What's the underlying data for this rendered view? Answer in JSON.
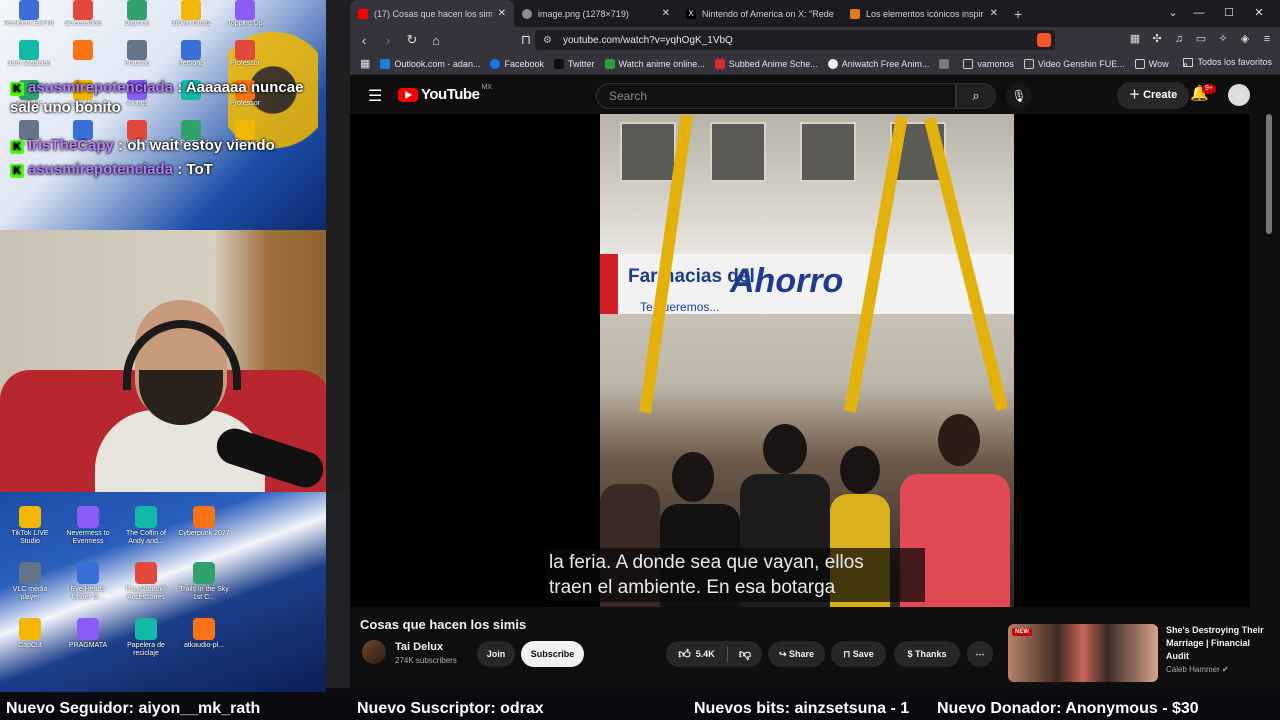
{
  "colors": {
    "yt_red": "#ff0000",
    "accent_chat_badge": "#53fc18",
    "browser_chrome": "#35343d",
    "tab_strip": "#1c1b22"
  },
  "chat": {
    "messages": [
      {
        "user": "asusmirepotenciada",
        "text": "Aaaaaaa nuncae sale uno bonito"
      },
      {
        "user": "IrisTheCapy",
        "text": "oh wait estoy viendo"
      },
      {
        "user": "asusmirepotenciada",
        "text": "ToT"
      }
    ]
  },
  "desktop_icons_top": [
    "Resident Evil Requiem",
    "Screenshots",
    "Digimon",
    "Brown Dust2",
    "Topping Up",
    "Sam Magician",
    "",
    "Phasmo",
    "Persona",
    "Professor",
    "Fairyside",
    "Launcher",
    "Vikings",
    "",
    "Professor",
    "Nira",
    "Streamer.bot",
    "Photopea",
    "SCRIPTLINK",
    "Palworld"
  ],
  "desktop_icons_bottom": [
    {
      "label": "TikTok LIVE Studio"
    },
    {
      "label": "Nevermess to Evermess"
    },
    {
      "label": "The Coffin of Andy and..."
    },
    {
      "label": "Cyberpunk 2077"
    },
    {
      "label": "VLC media player"
    },
    {
      "label": "Eve Hearts Under O..."
    },
    {
      "label": "PlayStation® Accessories"
    },
    {
      "label": "Trails in the Sky 1st C..."
    },
    {
      "label": "CapCut"
    },
    {
      "label": "PRAGMATA"
    },
    {
      "label": "Papelera de reciclaje"
    },
    {
      "label": "atkaudio-pl..."
    }
  ],
  "browser": {
    "tabs": [
      {
        "label": "(17) Cosas que hacen los simis -",
        "active": true,
        "icon": "youtube-icon",
        "color": "#ff0000"
      },
      {
        "label": "image.png (1278×719)",
        "active": false,
        "icon": "globe-icon",
        "color": "#8a8a8a"
      },
      {
        "label": "Nintendo of America on X: \"Redeem",
        "active": false,
        "icon": "x-icon",
        "color": "#000000"
      },
      {
        "label": "Los elementos icónicos inspirados en",
        "active": false,
        "icon": "article-icon",
        "color": "#e07b1a"
      }
    ],
    "url": "youtube.com/watch?v=yqhOgK_1VbQ",
    "bookmarks": [
      {
        "label": "Outlook.com - adan...",
        "color": "#1f7de0"
      },
      {
        "label": "Facebook",
        "color": "#1877f2"
      },
      {
        "label": "Twitter",
        "color": "#111111"
      },
      {
        "label": "Watch anime online...",
        "color": "#2ea043"
      },
      {
        "label": "Subbed Anime Sche...",
        "color": "#d12b2b"
      },
      {
        "label": "Aniwatch Free Anim...",
        "color": "#f2f2f2"
      },
      {
        "label": "",
        "color": "#777777"
      },
      {
        "label": "vamonos",
        "color": "#cccccc"
      },
      {
        "label": "Video Genshin FUE...",
        "color": "#cccccc"
      },
      {
        "label": "Wow",
        "color": "#cccccc"
      }
    ],
    "bookmarks_more": "»",
    "all_bookmarks": "Todos los favoritos"
  },
  "youtube": {
    "logo": "YouTube",
    "region": "MX",
    "search_placeholder": "Search",
    "create_label": "Create",
    "notifications": "9+",
    "captions": [
      "la feria. A donde sea que vayan, ellos",
      "traen el ambiente. En esa botarga"
    ],
    "video_sign": {
      "left": "Farmacias del",
      "right": "Ahorro",
      "sub": "Te queremos..."
    },
    "video_title": "Cosas que hacen los simis",
    "channel": {
      "name": "Tai Delux",
      "subs": "274K subscribers"
    },
    "join_label": "Join",
    "subscribe_label": "Subscribe",
    "likes": "5.4K",
    "share_label": "Share",
    "save_label": "Save",
    "thanks_label": "Thanks",
    "recommended": {
      "badge": "NEW",
      "title": "She's Destroying Their Marriage | Financial Audit",
      "channel": "Caleb Hammer"
    }
  },
  "ticker": [
    "Nuevo Seguidor: aiyon__mk_rath",
    "Nuevo Suscriptor: odrax",
    "Nuevos bits: ainzsetsuna - 1",
    "Nuevo Donador: Anonymous - $30"
  ]
}
